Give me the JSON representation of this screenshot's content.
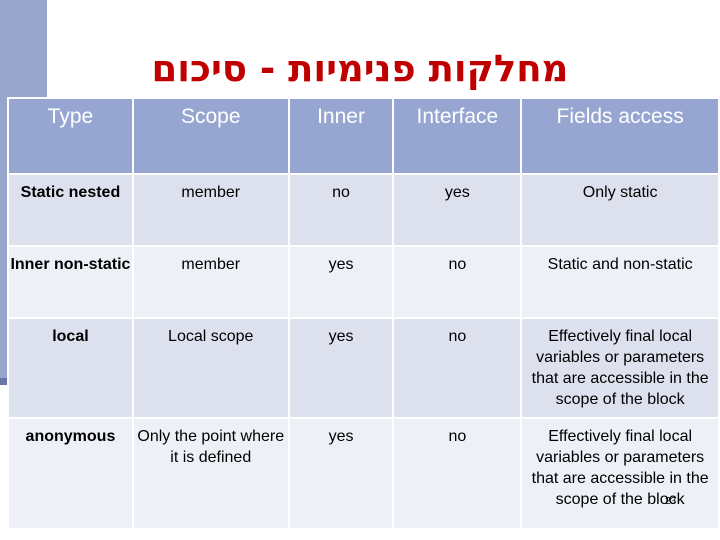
{
  "slide": {
    "title": "מחלקות פנימיות - סיכום",
    "page_number": "23",
    "accent_color": "#c00000",
    "header_color": "#96a6d0"
  },
  "table": {
    "headers": [
      "Type",
      "Scope",
      "Inner",
      "Interface",
      "Fields access"
    ],
    "rows": [
      [
        "Static nested",
        "member",
        "no",
        "yes",
        "Only static"
      ],
      [
        "Inner non-static",
        "member",
        "yes",
        "no",
        "Static and non-static"
      ],
      [
        "local",
        "Local scope",
        "yes",
        "no",
        "Effectively final local variables or parameters that are accessible in the scope of the block"
      ],
      [
        "anonymous",
        "Only the point where it is defined",
        "yes",
        "no",
        "Effectively final local variables or parameters that are accessible in the scope of the block"
      ]
    ]
  }
}
